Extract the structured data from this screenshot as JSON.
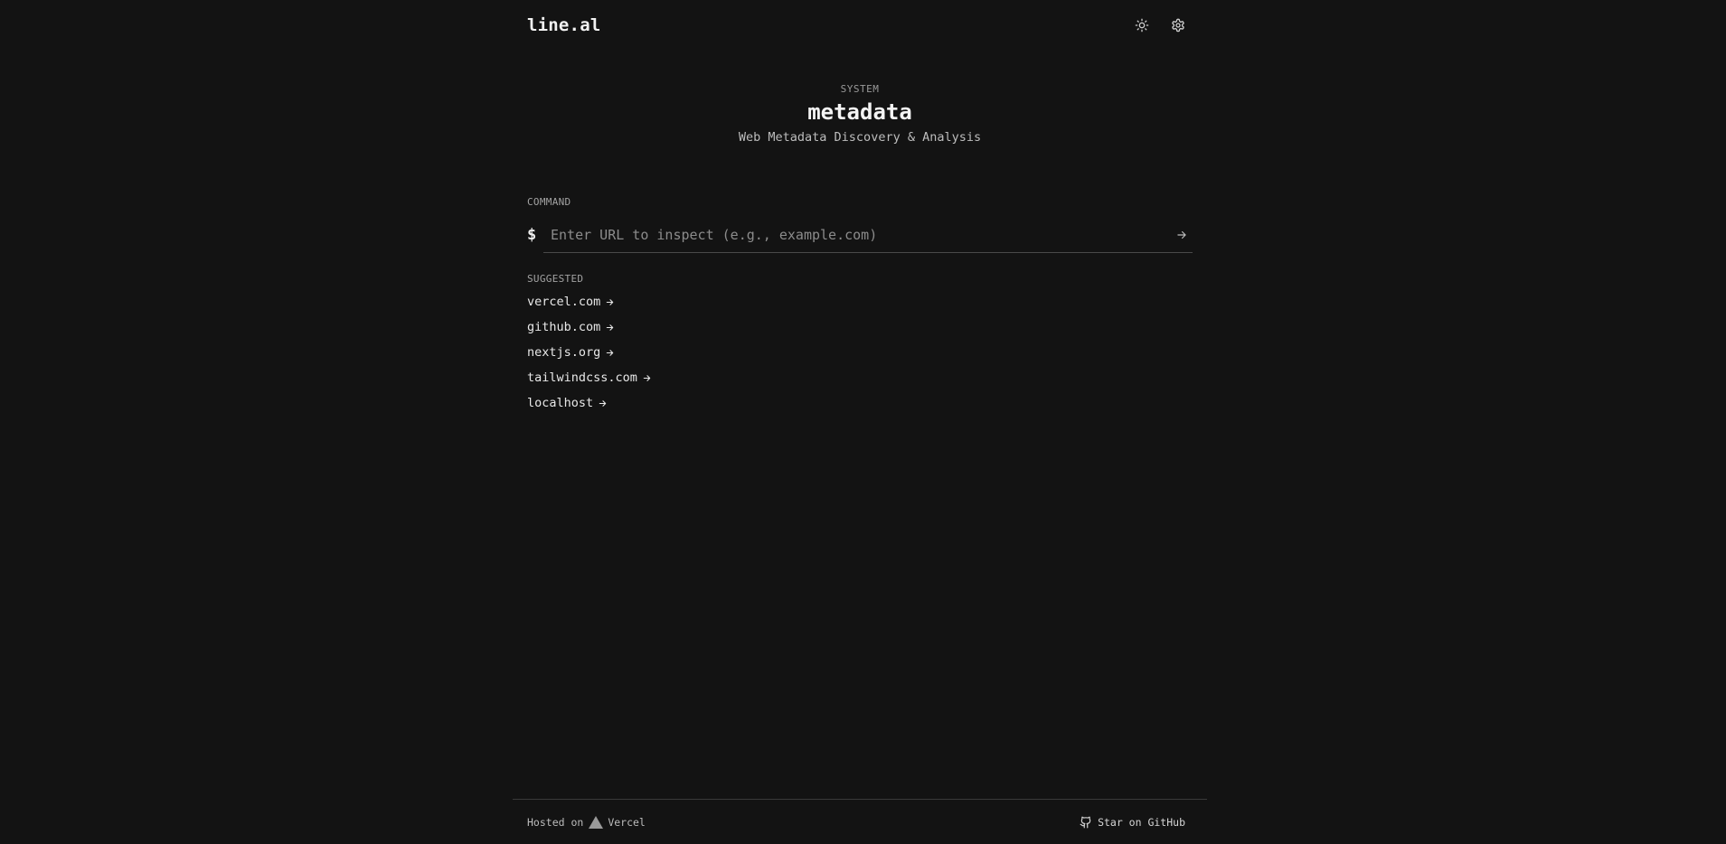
{
  "header": {
    "logo": "line.al",
    "icons": {
      "theme": "sun-icon",
      "settings": "gear-icon"
    }
  },
  "hero": {
    "eyebrow": "SYSTEM",
    "title": "metadata",
    "subtitle": "Web Metadata Discovery & Analysis"
  },
  "command": {
    "label": "COMMAND",
    "prompt": "$",
    "value": "",
    "placeholder": "Enter URL to inspect (e.g., example.com)"
  },
  "suggested": {
    "label": "SUGGESTED",
    "items": [
      "vercel.com",
      "github.com",
      "nextjs.org",
      "tailwindcss.com",
      "localhost"
    ]
  },
  "footer": {
    "hosted_prefix": "Hosted on",
    "host": "Vercel",
    "star": "Star on GitHub"
  },
  "colors": {
    "background": "#131313",
    "text": "#e6e6e6",
    "muted": "#9a9a9a",
    "border": "#3a3a3a"
  }
}
